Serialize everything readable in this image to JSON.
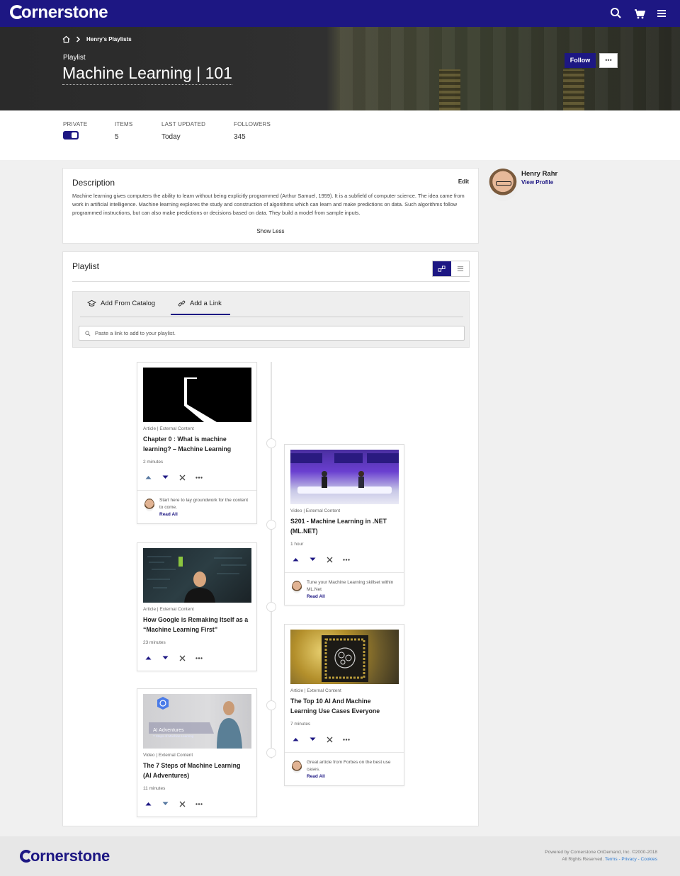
{
  "brand": {
    "logo_text": "ornerstone",
    "primary_color": "#1d1783"
  },
  "nav": {
    "icons": [
      "search-icon",
      "cart-icon",
      "menu-icon"
    ]
  },
  "hero": {
    "breadcrumb": "Henry's Playlists",
    "kicker": "Playlist",
    "title": "Machine Learning | 101",
    "follow_label": "Follow",
    "more_label": "•••"
  },
  "stats": {
    "private_label": "PRIVATE",
    "items_label": "ITEMS",
    "items_value": "5",
    "updated_label": "LAST UPDATED",
    "updated_value": "Today",
    "followers_label": "FOLLOWERS",
    "followers_value": "345"
  },
  "description": {
    "heading": "Description",
    "edit_label": "Edit",
    "body": "Machine learning gives computers the ability to learn without being explicitly programmed (Arthur Samuel, 1959). It is a subfield of computer science. The idea came from work in artificial intelligence. Machine learning explores the study and construction of algorithms which can learn and make predictions on data. Such algorithms follow programmed instructions, but can also make predictions or decisions based on data. They build a model from sample inputs.",
    "toggle_label": "Show Less"
  },
  "profile": {
    "name": "Henry Rahr",
    "link_label": "View Profile"
  },
  "playlist": {
    "heading": "Playlist",
    "tabs": [
      {
        "label": "Add From Catalog"
      },
      {
        "label": "Add a Link"
      }
    ],
    "link_placeholder": "Paste a link to add to your playlist.",
    "items": [
      {
        "type": "Article | External Content",
        "title": "Chapter 0 : What is machine learning? – Machine Learning",
        "duration": "2 minutes",
        "note": "Start here to lay groundwork for the content to come.",
        "read_all": "Read All"
      },
      {
        "type": "Video | External Content",
        "title": "S201 - Machine Learning in .NET (ML.NET)",
        "duration": "1 hour",
        "note": "Tune your Machine Learning skillset within ML.Net",
        "read_all": "Read All"
      },
      {
        "type": "Article | External Content",
        "title": "How Google is Remaking Itself as a “Machine Learning First”",
        "duration": "23 minutes"
      },
      {
        "type": "Article | External Content",
        "title": "The Top 10 AI And Machine Learning Use Cases Everyone",
        "duration": "7 minutes",
        "note": "Great article from Forbes on the best use cases.",
        "read_all": "Read All"
      },
      {
        "type": "Video | External Content",
        "title": "The 7 Steps of Machine Learning (AI Adventures)",
        "duration": "11 minutes",
        "thumb_text_1": "AI Adventures",
        "thumb_text_2": "7 Steps of Machine Learning"
      }
    ]
  },
  "footer": {
    "logo_text": "ornerstone",
    "powered": "Powered by Cornerstone OnDemand, Inc. ©2000-2018",
    "rights": "All Rights Reserved.",
    "terms": "Terms",
    "privacy": "Privacy",
    "cookies": "Cookies"
  }
}
